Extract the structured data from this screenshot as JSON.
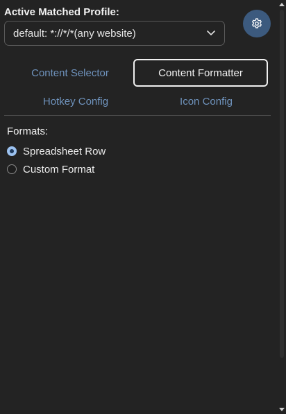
{
  "profile": {
    "heading": "Active Matched Profile:",
    "selected_value": "default: *://*/*(any website)",
    "settings_icon": "gear-icon",
    "dropdown_icon": "chevron-down-icon"
  },
  "tabs": [
    {
      "label": "Content Selector",
      "active": false
    },
    {
      "label": "Content Formatter",
      "active": true
    },
    {
      "label": "Hotkey Config",
      "active": false
    },
    {
      "label": "Icon Config",
      "active": false
    }
  ],
  "formats": {
    "heading": "Formats:",
    "options": [
      {
        "label": "Spreadsheet Row",
        "checked": true
      },
      {
        "label": "Custom Format",
        "checked": false
      }
    ]
  },
  "colors": {
    "background": "#232323",
    "accent": "#3c5a7e",
    "tab_inactive": "#6f93bd",
    "radio_checked": "#9cc2f0"
  }
}
